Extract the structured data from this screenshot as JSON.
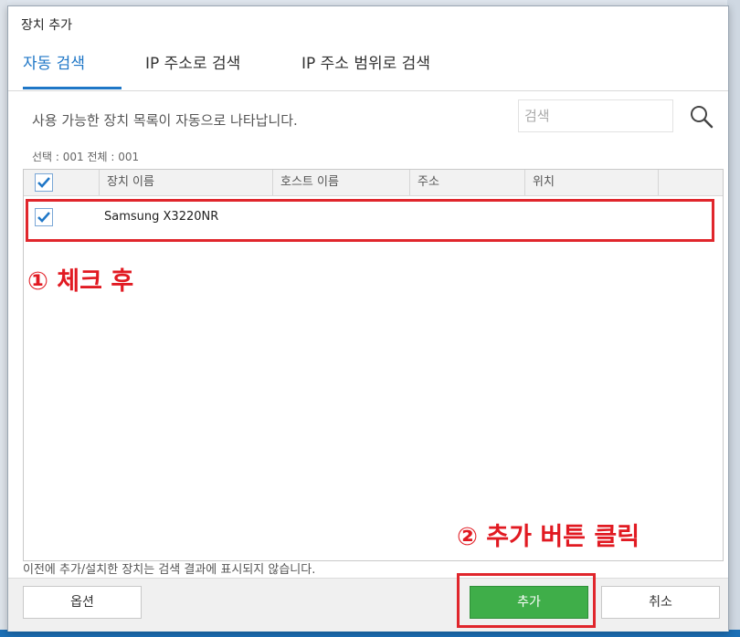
{
  "dialog": {
    "title": "장치 추가",
    "tabs": [
      "자동 검색",
      "IP 주소로 검색",
      "IP 주소 범위로 검색"
    ],
    "description": "사용 가능한 장치 목록이 자동으로 나타납니다.",
    "search_placeholder": "검색",
    "counts": "선택 : 001  전체 : 001",
    "table": {
      "columns": [
        "",
        "장치 이름",
        "호스트 이름",
        "주소",
        "위치",
        ""
      ],
      "rows": [
        {
          "checked": true,
          "device_name": "Samsung X3220NR"
        }
      ]
    },
    "footer_note": "이전에 추가/설치한 장치는 검색 결과에 표시되지 않습니다.",
    "buttons": {
      "options": "옵션",
      "add": "추가",
      "cancel": "취소"
    }
  },
  "annotations": {
    "step1": "① 체크 후",
    "step2": "② 추가 버튼 클릭"
  },
  "colors": {
    "accent": "#1f77c7",
    "add_button": "#3fae49",
    "highlight": "#e0262c"
  }
}
